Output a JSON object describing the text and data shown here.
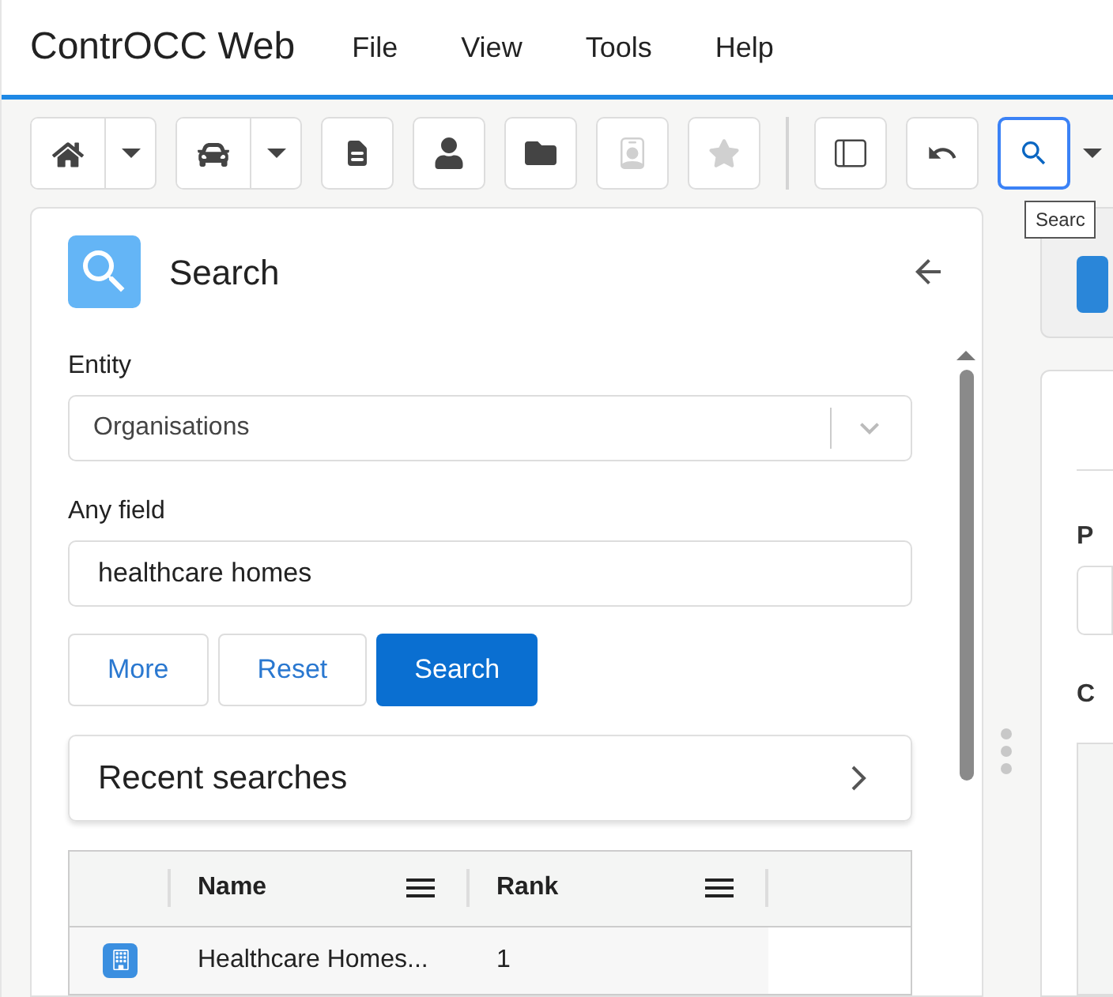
{
  "app": {
    "title": "ContrOCC Web",
    "menu": [
      "File",
      "View",
      "Tools",
      "Help"
    ]
  },
  "toolbar": [
    {
      "kind": "split",
      "disabled": false,
      "selected": false
    },
    {
      "kind": "split",
      "disabled": false,
      "selected": false
    },
    {
      "kind": "button",
      "disabled": false,
      "selected": false
    },
    {
      "kind": "button",
      "disabled": false,
      "selected": false
    },
    {
      "kind": "button",
      "disabled": false,
      "selected": false
    },
    {
      "kind": "button",
      "disabled": true,
      "selected": false
    },
    {
      "kind": "button",
      "disabled": true,
      "selected": false
    },
    {
      "kind": "separator"
    },
    {
      "kind": "button",
      "disabled": false,
      "selected": false
    },
    {
      "kind": "button",
      "disabled": false,
      "selected": false
    },
    {
      "kind": "split",
      "disabled": false,
      "selected": true
    }
  ],
  "tooltip": "Searc",
  "search_panel": {
    "title": "Search",
    "entity": {
      "label": "Entity",
      "value": "Organisations"
    },
    "any_field": {
      "label": "Any field",
      "value": "healthcare homes"
    },
    "buttons": [
      {
        "label": "More",
        "kind": "secondary"
      },
      {
        "label": "Reset",
        "kind": "secondary"
      },
      {
        "label": "Search",
        "kind": "primary"
      }
    ],
    "recent_searches": "Recent searches",
    "table": {
      "columns": [
        "Name",
        "Rank"
      ],
      "rows": [
        {
          "name": "Healthcare Homes...",
          "rank": "1"
        }
      ]
    }
  },
  "right_panel": {
    "labels": [
      "P",
      "C"
    ]
  }
}
